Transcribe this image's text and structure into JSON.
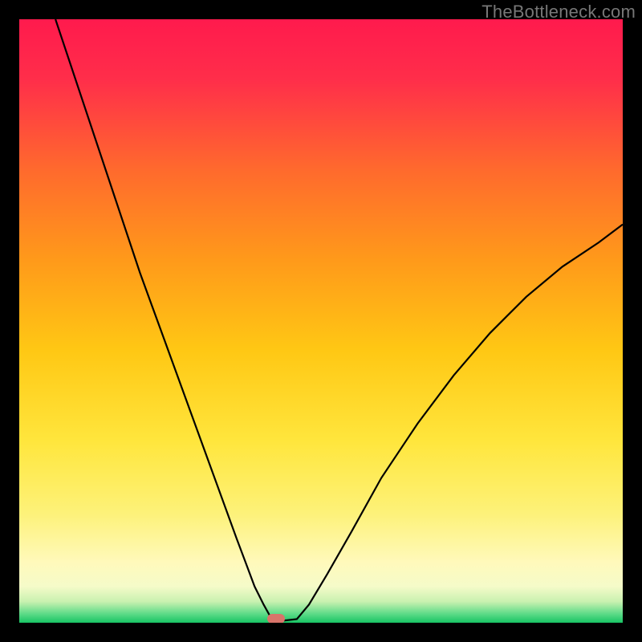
{
  "watermark": "TheBottleneck.com",
  "chart_data": {
    "type": "line",
    "title": "",
    "xlabel": "",
    "ylabel": "",
    "xlim": [
      0,
      100
    ],
    "ylim": [
      0,
      100
    ],
    "grid": false,
    "legend": false,
    "background_gradient": {
      "stops": [
        {
          "pos": 0.0,
          "color": "#ff1a4d"
        },
        {
          "pos": 0.1,
          "color": "#ff2e4a"
        },
        {
          "pos": 0.25,
          "color": "#ff6a2d"
        },
        {
          "pos": 0.4,
          "color": "#ff9a1a"
        },
        {
          "pos": 0.55,
          "color": "#ffc814"
        },
        {
          "pos": 0.7,
          "color": "#ffe63d"
        },
        {
          "pos": 0.82,
          "color": "#fdf27a"
        },
        {
          "pos": 0.9,
          "color": "#fff9bb"
        },
        {
          "pos": 0.94,
          "color": "#f5fbc9"
        },
        {
          "pos": 0.965,
          "color": "#c9f1b0"
        },
        {
          "pos": 0.985,
          "color": "#5edb88"
        },
        {
          "pos": 1.0,
          "color": "#18c464"
        }
      ]
    },
    "series": [
      {
        "name": "bottleneck-curve",
        "color": "#000000",
        "width": 2.2,
        "x": [
          6,
          8,
          10,
          12,
          14,
          16,
          18,
          20,
          22,
          24,
          26,
          28,
          30,
          32,
          34,
          36,
          37.5,
          39,
          40.5,
          41.5,
          42.5,
          46,
          48,
          51,
          55,
          60,
          66,
          72,
          78,
          84,
          90,
          96,
          100
        ],
        "y": [
          100,
          94,
          88,
          82,
          76,
          70,
          64,
          58,
          52.5,
          47,
          41.5,
          36,
          30.5,
          25,
          19.5,
          14,
          10,
          6,
          3,
          1.2,
          0.2,
          0.6,
          3,
          8,
          15,
          24,
          33,
          41,
          48,
          54,
          59,
          63,
          66
        ]
      }
    ],
    "marker": {
      "x": 42.5,
      "y": 0.6,
      "color": "#d9746a"
    }
  }
}
